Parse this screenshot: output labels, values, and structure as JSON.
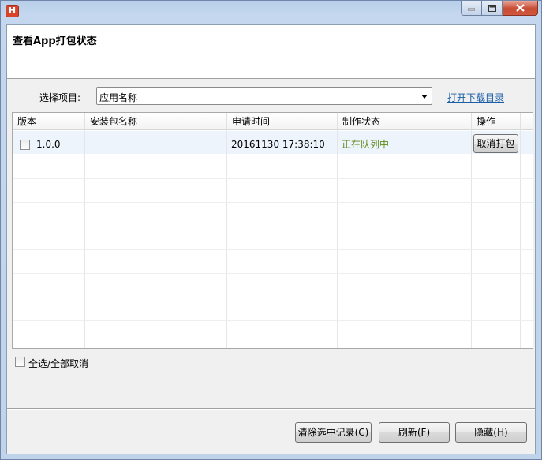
{
  "window": {
    "icon_letter": "H"
  },
  "header": {
    "title": "查看App打包状态"
  },
  "project": {
    "label": "选择项目:",
    "selected": "应用名称",
    "open_dir_link": "打开下载目录"
  },
  "table": {
    "columns": [
      "版本",
      "安装包名称",
      "申请时间",
      "制作状态",
      "操作"
    ],
    "rows": [
      {
        "checked": false,
        "version": "1.0.0",
        "package_name": "",
        "request_time": "20161130 17:38:10",
        "status": "正在队列中",
        "action_label": "取消打包"
      }
    ]
  },
  "footer": {
    "select_all_label": "全选/全部取消",
    "clear_button": "清除选中记录(C)",
    "refresh_button": "刷新(F)",
    "hide_button": "隐藏(H)"
  },
  "colors": {
    "status_queued": "#5f8a1e",
    "link": "#1a5ea8",
    "close_button": "#c74c33"
  }
}
